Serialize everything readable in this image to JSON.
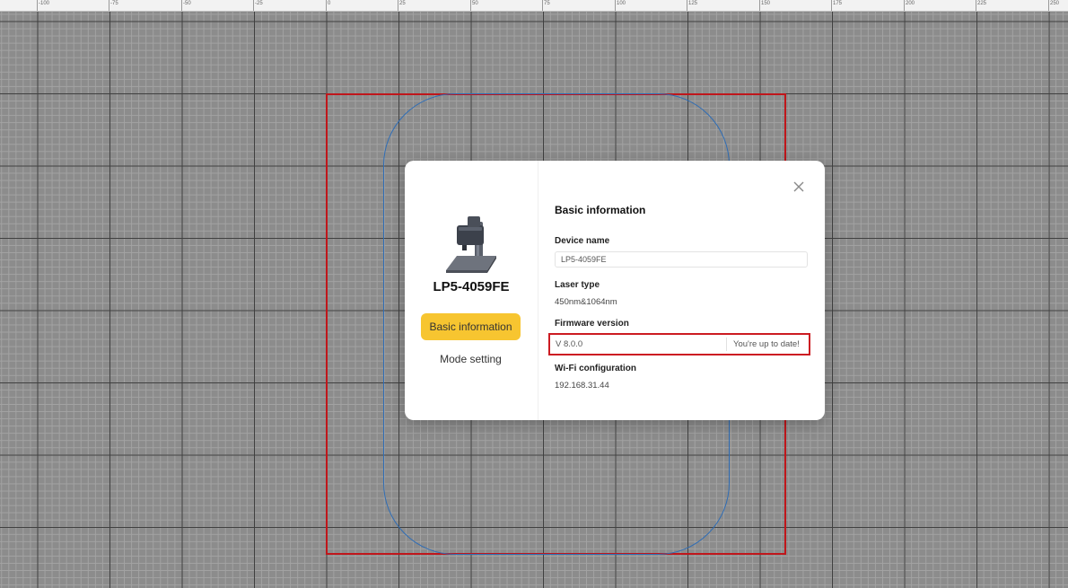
{
  "ruler": {
    "ticks": [
      "-100",
      "-75",
      "-50",
      "-25",
      "0",
      "25",
      "50",
      "75",
      "100",
      "125",
      "150",
      "175",
      "200",
      "225",
      "250"
    ]
  },
  "dialog": {
    "device_title": "LP5-4059FE",
    "nav": {
      "basic_information": "Basic information",
      "mode_setting": "Mode setting"
    },
    "close_icon": "close-icon",
    "section_title": "Basic information",
    "device_name_label": "Device name",
    "device_name_value": "LP5-4059FE",
    "laser_type_label": "Laser type",
    "laser_type_value": "450nm&1064nm",
    "firmware_label": "Firmware version",
    "firmware_value": "V 8.0.0",
    "firmware_status": "You're up to date!",
    "wifi_label": "Wi-Fi configuration",
    "wifi_value": "192.168.31.44"
  },
  "colors": {
    "accent": "#f7c530",
    "work_area_border": "#c0161b",
    "shape_outline": "#2f6db5",
    "highlight_box": "#cc1b22"
  }
}
